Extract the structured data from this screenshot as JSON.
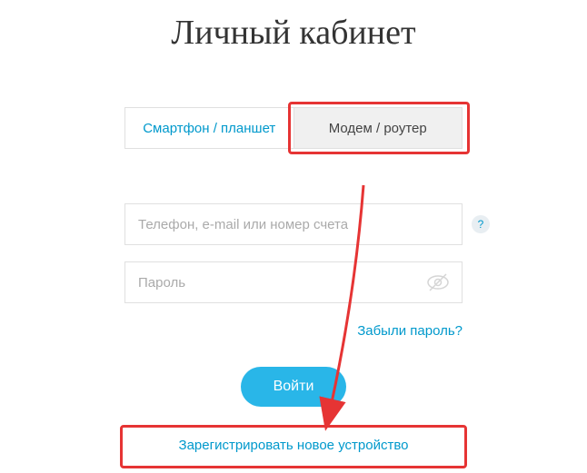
{
  "page": {
    "title": "Личный кабинет"
  },
  "tabs": {
    "inactive_label": "Смартфон / планшет",
    "active_label": "Модем / роутер"
  },
  "inputs": {
    "login_placeholder": "Телефон, e-mail или номер счета",
    "password_placeholder": "Пароль"
  },
  "help": {
    "symbol": "?"
  },
  "links": {
    "forgot": "Забыли пароль?",
    "register": "Зарегистрировать новое устройство"
  },
  "buttons": {
    "login": "Войти"
  },
  "colors": {
    "accent": "#29b6e8",
    "link": "#0099cc",
    "highlight": "#e63434"
  }
}
